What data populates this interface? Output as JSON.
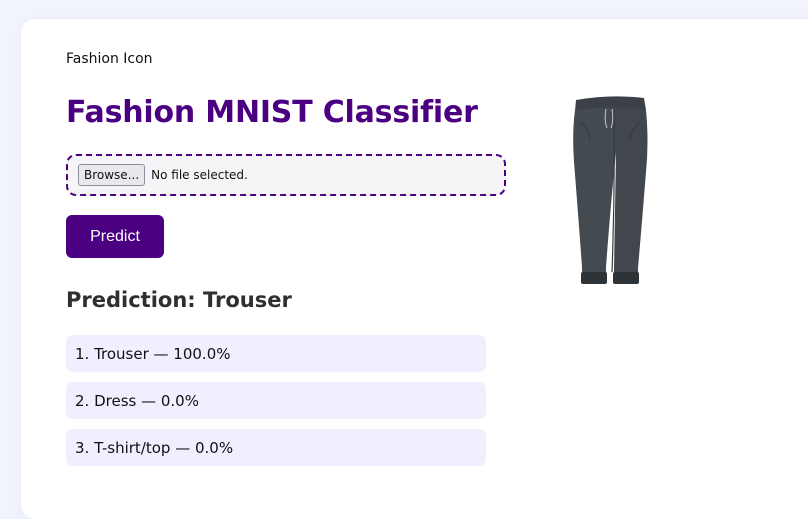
{
  "header": {
    "brand": "Fashion Icon",
    "title": "Fashion MNIST Classifier"
  },
  "upload": {
    "browse_label": "Browse...",
    "status": "No file selected."
  },
  "actions": {
    "predict_label": "Predict"
  },
  "result": {
    "heading": "Prediction: Trouser",
    "items": [
      {
        "text": "1. Trouser — 100.0%"
      },
      {
        "text": "2. Dress — 0.0%"
      },
      {
        "text": "3. T-shirt/top — 0.0%"
      }
    ]
  },
  "preview": {
    "image": "trouser-image",
    "colors": {
      "fabric": "#434a50",
      "shadow": "#2e3338"
    }
  },
  "theme": {
    "accent": "#4b0082",
    "page_background": "#f1f3fd",
    "result_item_background": "#f0efff"
  }
}
